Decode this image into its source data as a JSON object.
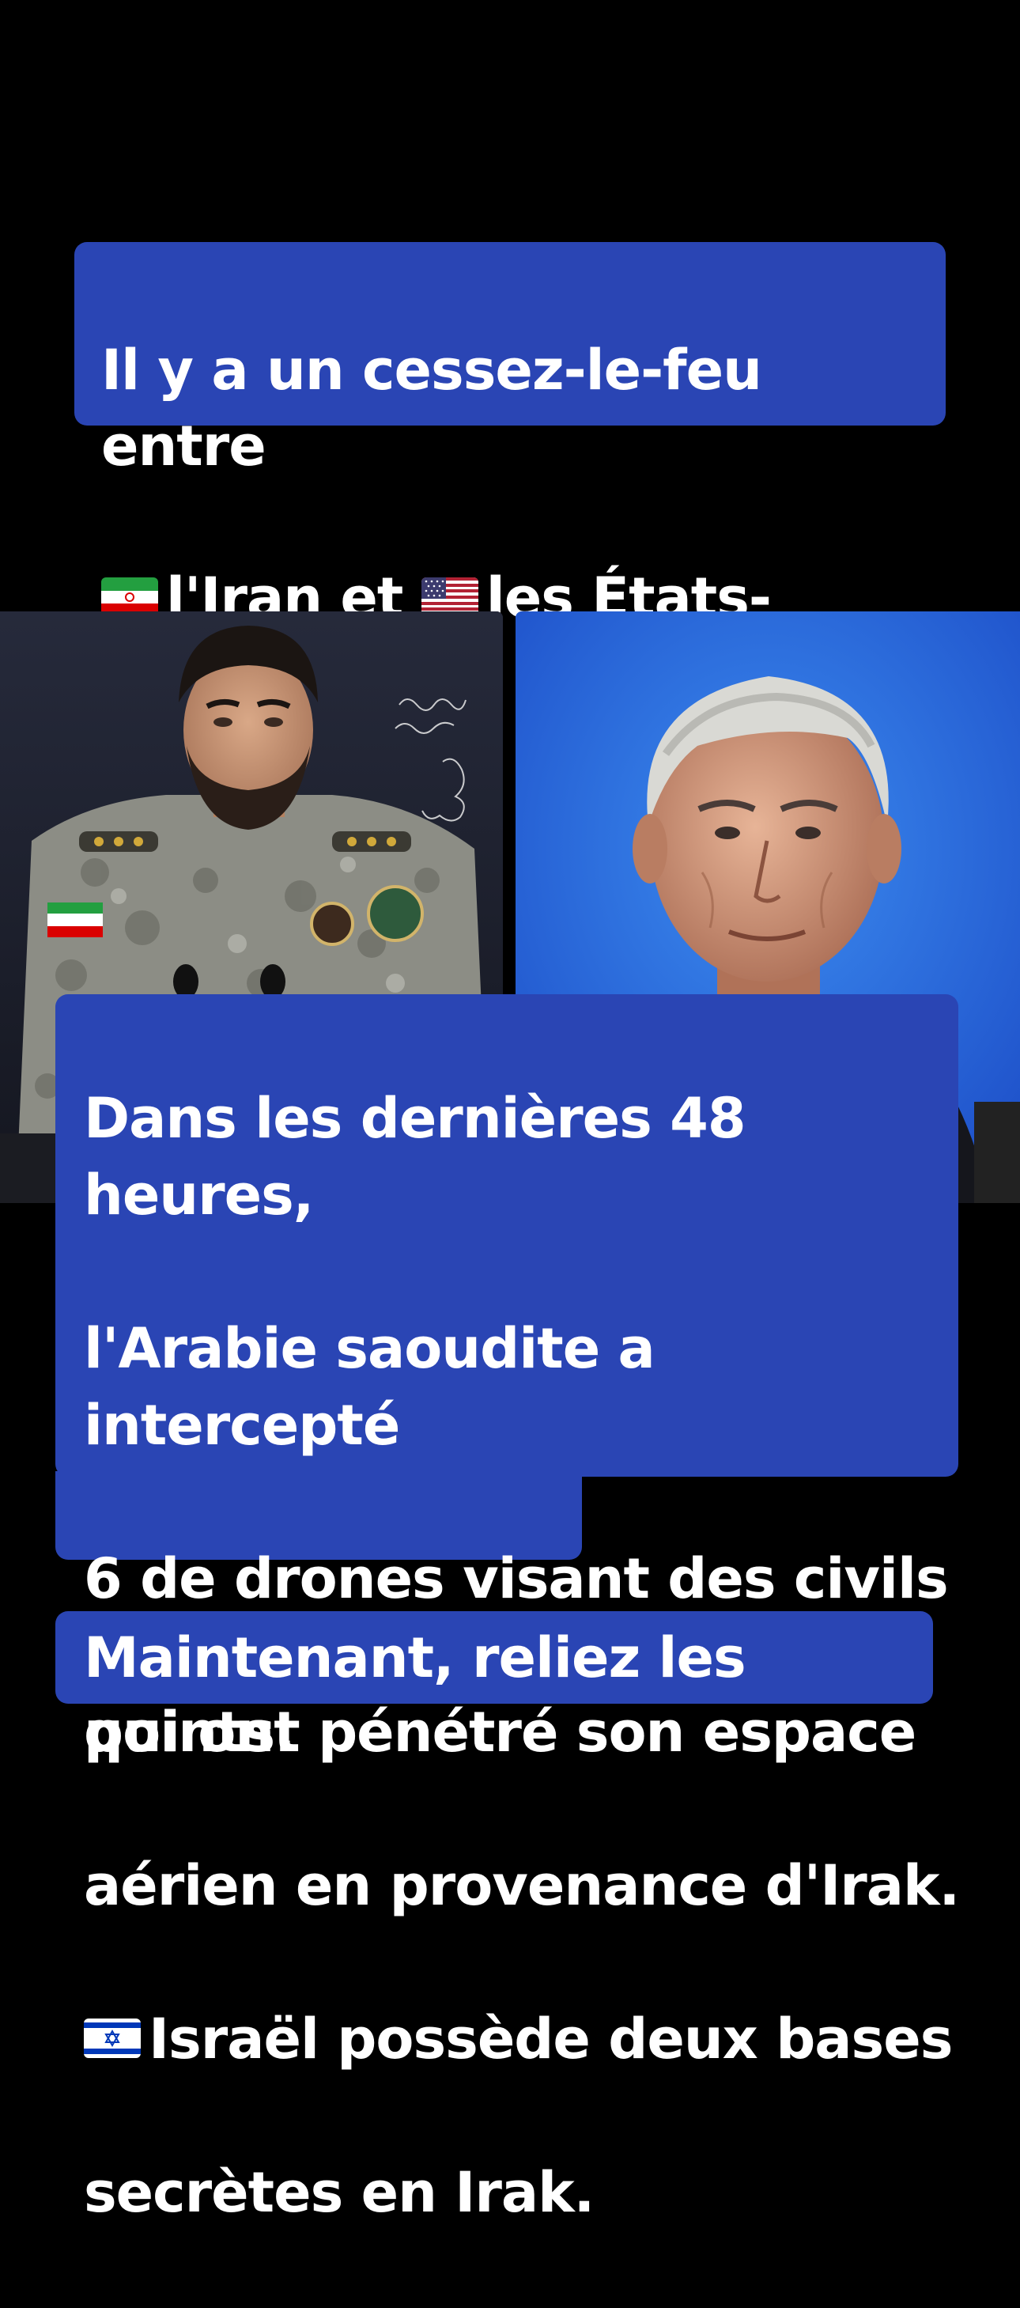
{
  "captions": {
    "first": {
      "line1": "Il y a un cessez-le-feu entre",
      "line2_part1": "l'Iran et",
      "line2_part2": "les États-Unis.",
      "flag_iran": "iran-flag-icon",
      "flag_usa": "usa-flag-icon"
    },
    "second": {
      "line1": "Dans les dernières 48 heures,",
      "line2": "l'Arabie saoudite a intercepté",
      "line3": "6 de drones visant des civils",
      "line4": "qui ont pénétré son espace",
      "line5": "aérien en provenance d'Irak.",
      "line6": "Israël possède deux bases",
      "line7": "secrètes en Irak.",
      "flag_israel": "israel-flag-icon"
    },
    "third": {
      "text": "Maintenant, reliez les points."
    }
  },
  "colors": {
    "background": "#000000",
    "caption_bg": "#2a45b4",
    "caption_text": "#ffffff"
  }
}
